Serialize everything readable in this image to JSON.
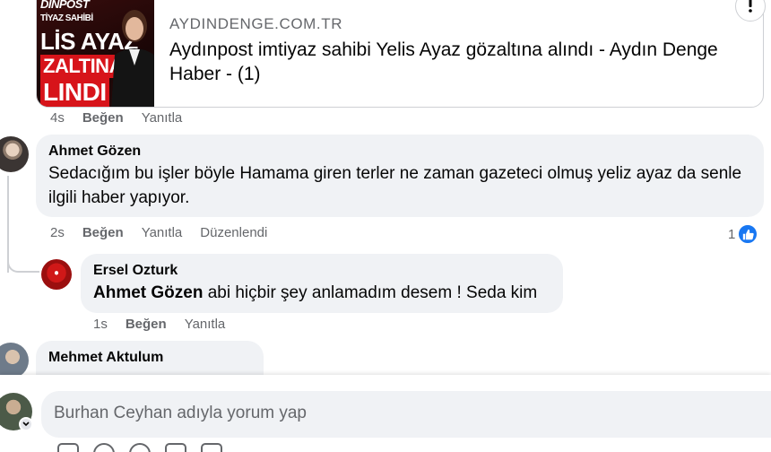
{
  "link_preview": {
    "thumbnail_lines": [
      "DINPOST",
      "TİYAZ SAHİBİ",
      "LİS AYAZ",
      "ZALTINA",
      "LINDI"
    ],
    "site": "AYDINDENGE.COM.TR",
    "title": "Aydınpost imtiyaz sahibi Yelis Ayaz gözaltına alındı - Aydın Denge Haber - (1)",
    "more_icon": "more-icon",
    "actions": {
      "time": "4s",
      "like": "Beğen",
      "reply": "Yanıtla"
    }
  },
  "comments": [
    {
      "author": "Ahmet Gözen",
      "text": "Sedacığım bu işler böyle Hamama giren terler ne zaman gazeteci olmuş yeliz ayaz da senle ilgili haber yapıyor.",
      "actions": {
        "time": "2s",
        "like": "Beğen",
        "reply": "Yanıtla",
        "edited": "Düzenlendi"
      },
      "reaction_count": "1",
      "reaction_icon": "like-icon"
    },
    {
      "author": "Ersel Ozturk",
      "mention": "Ahmet Gözen",
      "text": " abi hiçbir şey anlamadım desem ! Seda kim",
      "actions": {
        "time": "1s",
        "like": "Beğen",
        "reply": "Yanıtla"
      }
    },
    {
      "author": "Mehmet Aktulum"
    }
  ],
  "composer": {
    "placeholder": "Burhan Ceyhan adıyla yorum yap"
  },
  "colors": {
    "bubble": "#f0f2f5",
    "secondary_text": "#65676b",
    "like_blue": "#1877f2",
    "divider": "#ced0d4"
  }
}
